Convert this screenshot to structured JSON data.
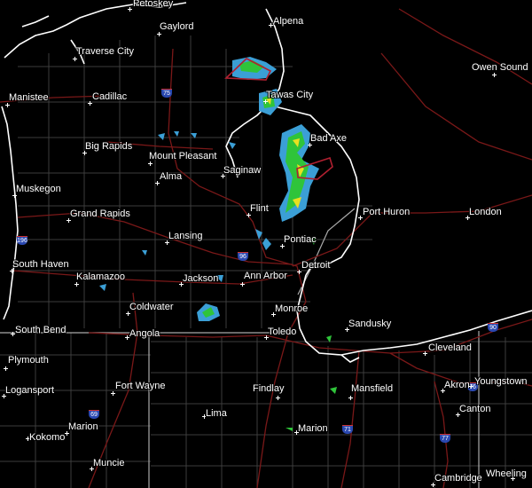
{
  "map": {
    "cities": {
      "petoskey": "Petoskey",
      "gaylord": "Gaylord",
      "alpena": "Alpena",
      "traverse_city": "Traverse City",
      "owen_sound": "Owen Sound",
      "manistee": "Manistee",
      "cadillac": "Cadillac",
      "tawas_city": "Tawas City",
      "big_rapids": "Big Rapids",
      "bad_axe": "Bad Axe",
      "mount_pleasant": "Mount Pleasant",
      "alma": "Alma",
      "saginaw": "Saginaw",
      "muskegon": "Muskegon",
      "grand_rapids": "Grand Rapids",
      "flint": "Flint",
      "port_huron": "Port Huron",
      "london": "London",
      "lansing": "Lansing",
      "pontiac": "Pontiac",
      "south_haven": "South Haven",
      "detroit": "Detroit",
      "kalamazoo": "Kalamazoo",
      "jackson": "Jackson",
      "ann_arbor": "Ann Arbor",
      "coldwater": "Coldwater",
      "monroe": "Monroe",
      "south_bend": "South Bend",
      "angola": "Angola",
      "toledo": "Toledo",
      "sandusky": "Sandusky",
      "cleveland": "Cleveland",
      "plymouth": "Plymouth",
      "fort_wayne": "Fort Wayne",
      "findlay": "Findlay",
      "akron": "Akron",
      "youngstown": "Youngstown",
      "logansport": "Logansport",
      "marion_in": "Marion",
      "lima": "Lima",
      "mansfield": "Mansfield",
      "canton": "Canton",
      "kokomo": "Kokomo",
      "marion_oh": "Marion",
      "muncie": "Muncie",
      "cambridge": "Cambridge",
      "wheeling": "Wheeling"
    },
    "interstates": {
      "i75_north": "75",
      "i196": "196",
      "i96": "96",
      "i69": "69",
      "i71": "71",
      "i77": "77",
      "i90": "90",
      "i76": "76"
    },
    "colors": {
      "background": "#000000",
      "coastline": "#ffffff",
      "state_border": "#b0b0b0",
      "county_line": "#4a4a4a",
      "highway": "#7a1818",
      "warning_polygon": "#b02030",
      "radar_light": "#3b9fd6",
      "radar_green": "#2fc43a",
      "radar_yellow": "#e8e020"
    }
  }
}
